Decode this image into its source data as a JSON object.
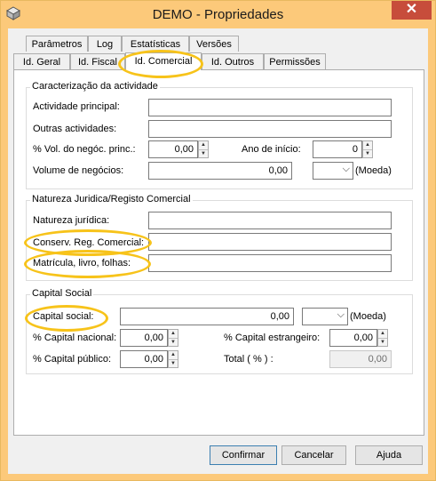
{
  "window": {
    "title": "DEMO - Propriedades",
    "close_symbol": "✕"
  },
  "tabs_row1": [
    "Parâmetros",
    "Log",
    "Estatísticas",
    "Versões"
  ],
  "tabs_row2": [
    "Id. Geral",
    "Id. Fiscal",
    "Id. Comercial",
    "Id. Outros",
    "Permissões"
  ],
  "group1": {
    "title": "Caracterização da actividade",
    "actividade_principal_label": "Actividade principal:",
    "outras_actividades_label": "Outras actividades:",
    "vol_label": "% Vol. do negóc. princ.:",
    "vol_value": "0,00",
    "ano_label": "Ano de início:",
    "ano_value": "0",
    "volume_label": "Volume de negócios:",
    "volume_value": "0,00",
    "moeda_label": "(Moeda)"
  },
  "group2": {
    "title": "Natureza Juridica/Registo Comercial",
    "natureza_label": "Natureza jurídica:",
    "conserv_label": "Conserv. Reg. Comercial:",
    "matricula_label": "Matrícula, livro, folhas:"
  },
  "group3": {
    "title": "Capital Social",
    "capital_label": "Capital social:",
    "capital_value": "0,00",
    "moeda_label": "(Moeda)",
    "nacional_label": "% Capital nacional:",
    "nacional_value": "0,00",
    "estrangeiro_label": "% Capital estrangeiro:",
    "estrangeiro_value": "0,00",
    "publico_label": "% Capital público:",
    "publico_value": "0,00",
    "total_label": "Total ( % ) :",
    "total_value": "0,00"
  },
  "buttons": {
    "confirm": "Confirmar",
    "cancel": "Cancelar",
    "help": "Ajuda"
  },
  "colors": {
    "title_bar": "#fcc97a",
    "close_button": "#c74d3b",
    "highlight": "#f7c31a"
  }
}
